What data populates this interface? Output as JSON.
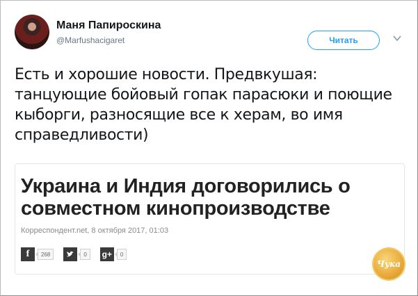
{
  "user": {
    "name": "Маня Папироскина",
    "handle": "@Marfushacigaret"
  },
  "follow_label": "Читать",
  "tweet_text": "Есть и хорошие новости. Предвкушая: танцующие бойовый гопак парасюки и поющие кыборги, разносящие все к херам, во имя справедливости)",
  "card": {
    "headline": "Украина и Индия договорились о совместном кинопроизводстве",
    "source_date": "Корреспондент.net, 8 октября 2017, 01:03",
    "share": {
      "facebook_count": "268",
      "twitter_count": "0",
      "gplus_count": "0",
      "facebook_icon": "facebook-icon",
      "twitter_icon": "twitter-icon",
      "gplus_icon": "google-plus-icon",
      "gplus_label": "g+"
    }
  },
  "watermark": "Чука",
  "colors": {
    "accent": "#1da1f2",
    "text": "#14171a",
    "muted": "#657786"
  }
}
